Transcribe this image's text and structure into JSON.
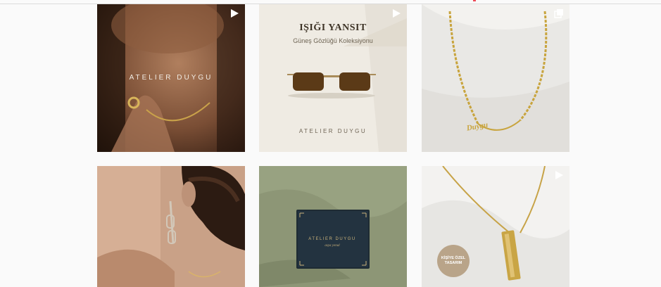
{
  "colors": {
    "page_background": "#fafafa",
    "divider": "#dbdbdb",
    "gold": "#c8a43d"
  },
  "feed": {
    "posts": [
      {
        "type_icon": "reel-play-icon",
        "overlay_text": "ATELIER DUYGU"
      },
      {
        "type_icon": "reel-play-icon",
        "title": "IŞIĞI YANSIT",
        "subtitle": "Güneş Gözlüğü Koleksiyonu",
        "brand": "ATELIER DUYGU"
      },
      {
        "type_icon": "carousel-icon",
        "pendant_text": "Duygu"
      },
      {
        "type_icon": ""
      },
      {
        "type_icon": "",
        "box_brand": "ATELIER DUYGU",
        "box_subtitle": "asya yenal"
      },
      {
        "type_icon": "reel-play-icon",
        "stamp_line1": "KİŞİYE ÖZEL",
        "stamp_line2": "TASARIM"
      }
    ]
  }
}
